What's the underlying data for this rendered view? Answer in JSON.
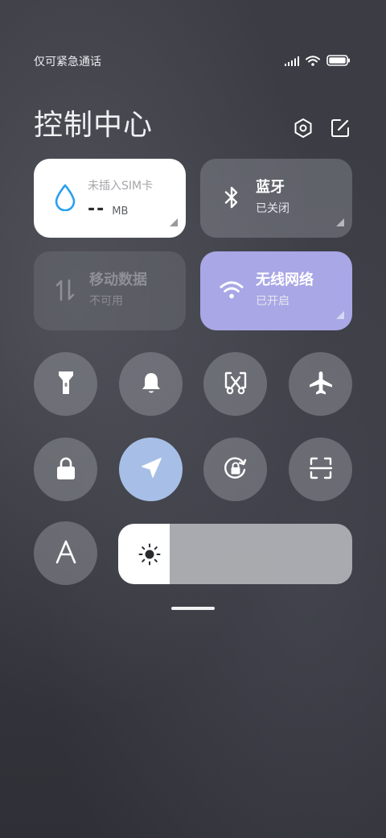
{
  "status_bar": {
    "carrier_text": "仅可紧急通话",
    "icons": [
      "signal-icon",
      "wifi-icon",
      "battery-icon"
    ]
  },
  "header": {
    "title": "控制中心",
    "actions": [
      "settings-icon",
      "edit-icon"
    ]
  },
  "tiles": {
    "data_usage": {
      "label": "未插入SIM卡",
      "value": "--",
      "unit": "MB",
      "icon": "water-drop-icon",
      "accent": "#2aa0ef"
    },
    "bluetooth": {
      "title": "蓝牙",
      "status": "已关闭",
      "icon": "bluetooth-icon"
    },
    "mobile_data": {
      "title": "移动数据",
      "status": "不可用",
      "icon": "data-arrows-icon"
    },
    "wifi": {
      "title": "无线网络",
      "status": "已开启",
      "icon": "wifi-icon",
      "accent": "#a9a7e6"
    }
  },
  "toggles_row1": [
    {
      "icon": "flashlight-icon",
      "active": false
    },
    {
      "icon": "bell-icon",
      "active": false
    },
    {
      "icon": "screenshot-icon",
      "active": false
    },
    {
      "icon": "airplane-icon",
      "active": false
    }
  ],
  "toggles_row2": [
    {
      "icon": "lock-icon",
      "active": false
    },
    {
      "icon": "location-icon",
      "active": true,
      "accent": "#a7bfe7"
    },
    {
      "icon": "rotation-lock-icon",
      "active": false
    },
    {
      "icon": "scan-icon",
      "active": false
    }
  ],
  "font_toggle": {
    "icon": "font-size-icon",
    "glyph": "A"
  },
  "brightness": {
    "icon": "sun-icon",
    "level": 0.22
  }
}
